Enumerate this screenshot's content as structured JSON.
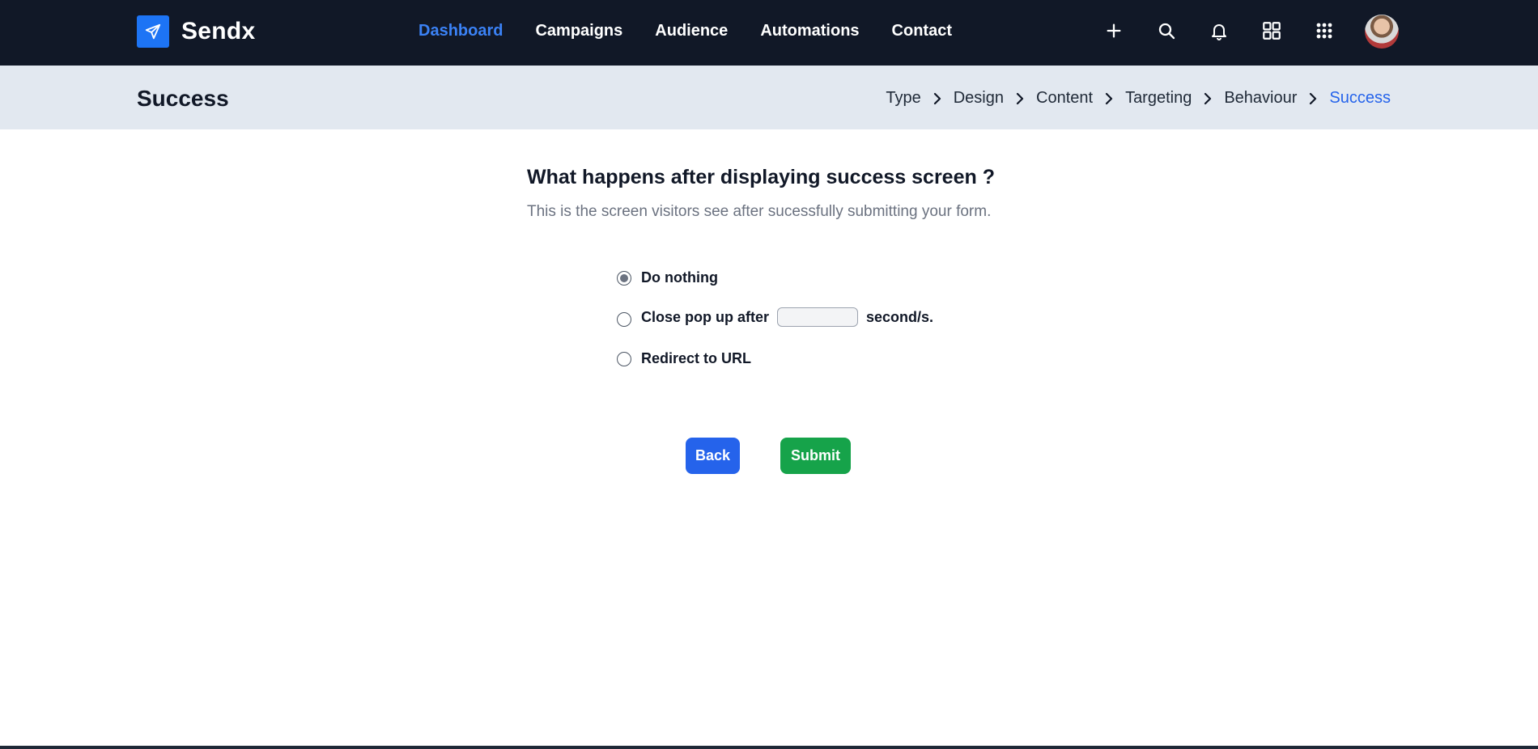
{
  "app": {
    "name": "Sendx"
  },
  "nav": {
    "links": [
      {
        "label": "Dashboard",
        "active": true
      },
      {
        "label": "Campaigns",
        "active": false
      },
      {
        "label": "Audience",
        "active": false
      },
      {
        "label": "Automations",
        "active": false
      },
      {
        "label": "Contact",
        "active": false
      }
    ],
    "icons": [
      "plus-icon",
      "search-icon",
      "bell-icon",
      "dashboard-grid-icon",
      "apps-grid-icon"
    ]
  },
  "subheader": {
    "title": "Success",
    "breadcrumb": [
      "Type",
      "Design",
      "Content",
      "Targeting",
      "Behaviour",
      "Success"
    ]
  },
  "main": {
    "question": "What happens after displaying success screen ?",
    "subtitle": "This is the screen visitors see after sucessfully submitting your form.",
    "options": {
      "do_nothing": "Do nothing",
      "close_prefix": "Close pop up after",
      "close_suffix": "second/s.",
      "redirect": "Redirect to URL"
    },
    "selected_option": "do_nothing",
    "seconds_value": ""
  },
  "buttons": {
    "back": "Back",
    "submit": "Submit"
  },
  "colors": {
    "nav_bg": "#111827",
    "accent": "#3b82f6",
    "subheader_bg": "#e2e8f0",
    "back_button": "#2563eb",
    "submit_button": "#16a34a",
    "logo_bg": "#1d74f5"
  }
}
